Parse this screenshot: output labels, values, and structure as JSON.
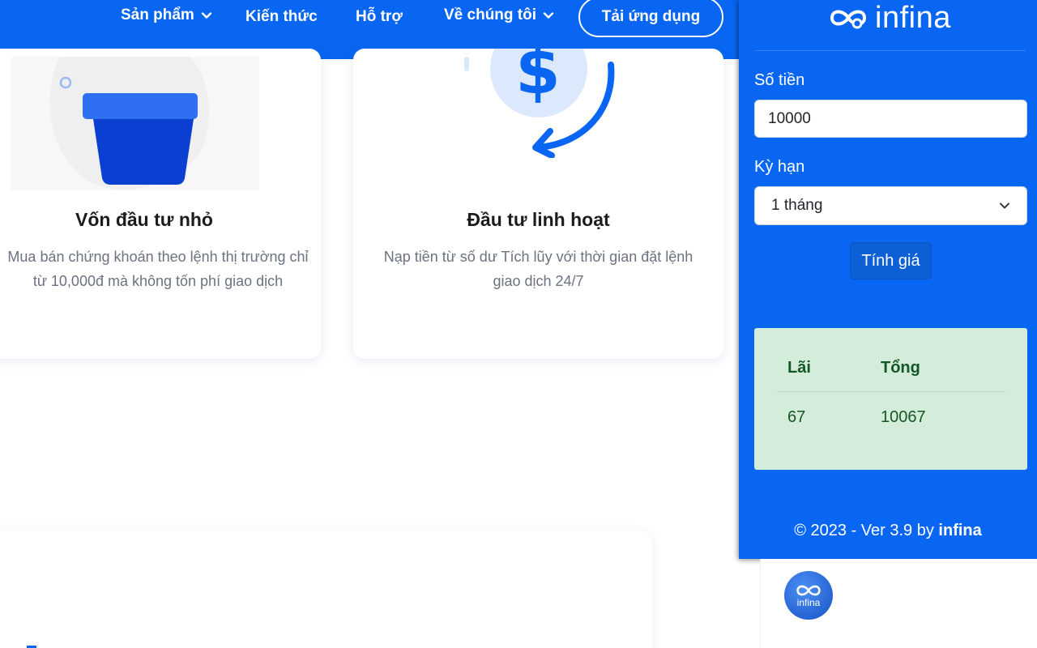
{
  "nav": {
    "items": [
      "Sản phẩm",
      "Kiến thức",
      "Hỗ trợ",
      "Về chúng tôi"
    ],
    "cta": "Tải ứng dụng"
  },
  "features": [
    {
      "title": "Vốn đầu tư nhỏ",
      "desc": "Mua bán chứng khoán theo lệnh thị trường chỉ từ 10,000đ mà không tốn phí giao dịch"
    },
    {
      "title": "Đầu tư linh hoạt",
      "desc": "Nạp tiền từ số dư Tích lũy với thời gian đặt lệnh giao dịch 24/7"
    }
  ],
  "popup": {
    "logo_text": "infina",
    "amount_label": "Số tiền",
    "amount_value": "10000",
    "term_label": "Kỳ hạn",
    "term_value": "1 tháng",
    "calc_button": "Tính giá",
    "result": {
      "interest_header": "Lãi",
      "total_header": "Tổng",
      "interest_value": "67",
      "total_value": "10067"
    },
    "footer_prefix": "© 2023 - Ver 3.9 by ",
    "footer_brand": "infina"
  },
  "avatar_text": "infina",
  "colors": {
    "brand_blue": "#0866f2",
    "success_bg": "#d4edda",
    "success_text": "#155724"
  }
}
